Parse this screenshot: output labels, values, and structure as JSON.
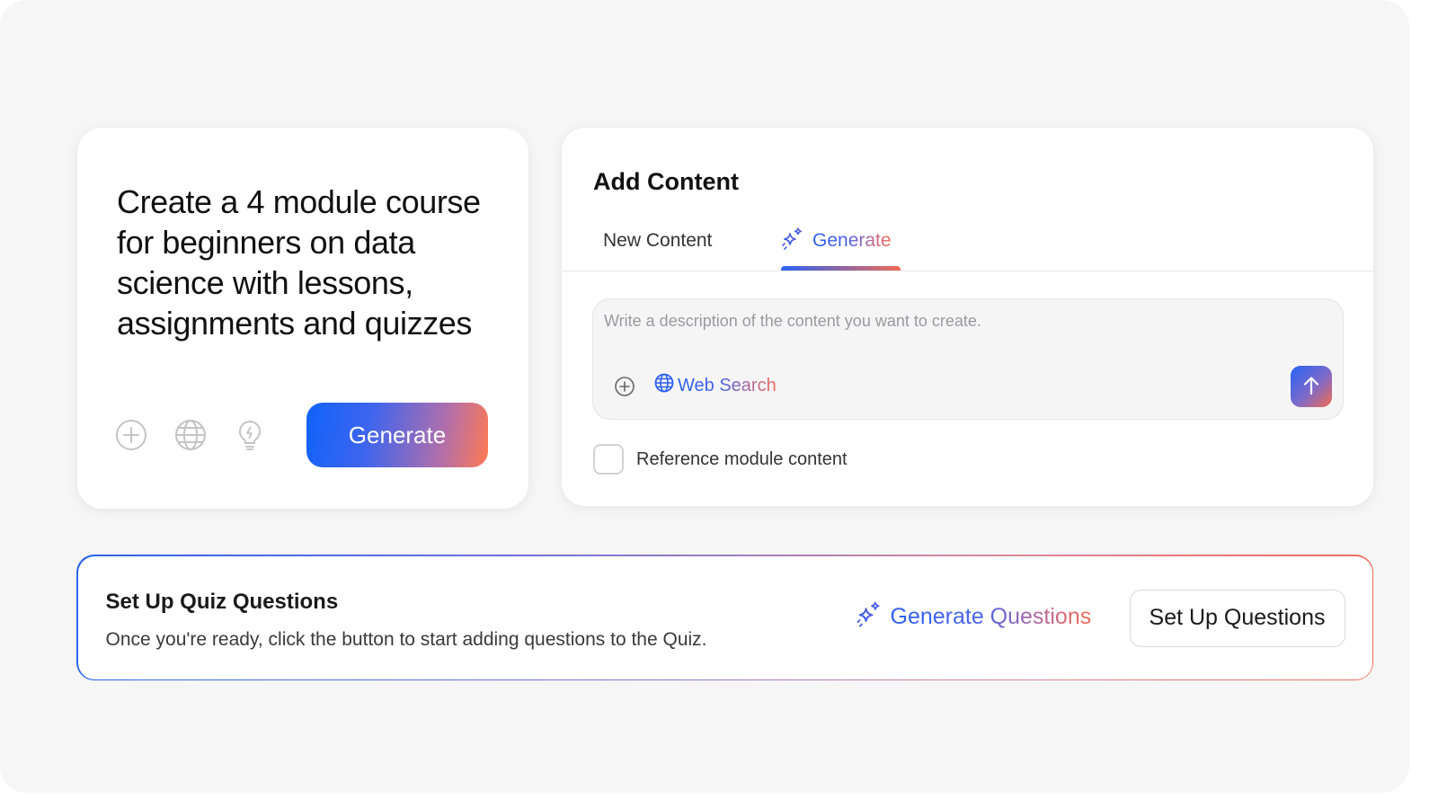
{
  "prompt_card": {
    "text": "Create a 4 module course for beginners on data science with lessons, assignments and quizzes",
    "tools": [
      "plus-circle-icon",
      "globe-icon",
      "lightbulb-icon"
    ],
    "generate_label": "Generate"
  },
  "add_content": {
    "title": "Add Content",
    "tabs": [
      {
        "label": "New Content",
        "active": false
      },
      {
        "label": "Generate",
        "active": true,
        "icon": "sparkles-icon"
      }
    ],
    "description_placeholder": "Write a description of the content you want to create.",
    "web_search_label": "Web Search",
    "reference_label": "Reference module content",
    "reference_checked": false
  },
  "quiz": {
    "title": "Set Up Quiz Questions",
    "description": "Once you're ready, click the button to start adding questions to the Quiz.",
    "generate_label": "Generate Questions",
    "setup_label": "Set Up Questions"
  },
  "colors": {
    "accent_blue": "#1062fa",
    "accent_orange": "#ff7a53",
    "background": "#f6f6f7"
  }
}
